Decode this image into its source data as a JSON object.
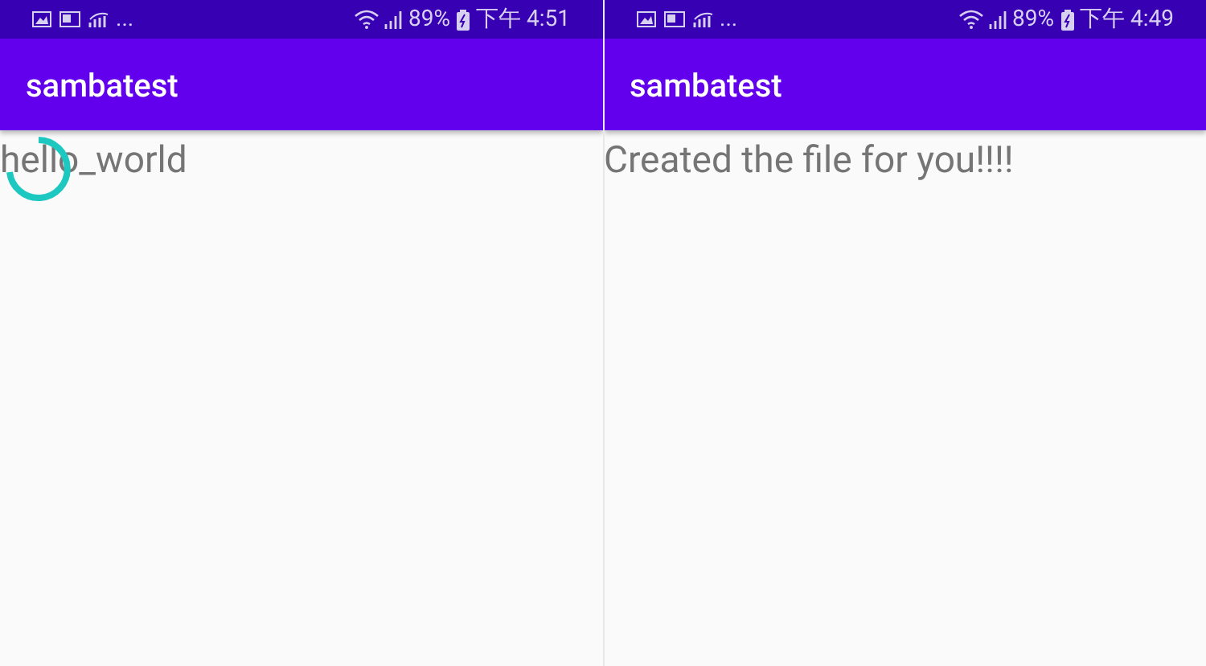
{
  "screens": [
    {
      "status_bar": {
        "more": "...",
        "battery": "89%",
        "time": "下午 4:51"
      },
      "title": "sambatest",
      "message": "hello_world",
      "loading": true
    },
    {
      "status_bar": {
        "more": "...",
        "battery": "89%",
        "time": "下午 4:49"
      },
      "title": "sambatest",
      "message": "Created the file for you!!!!",
      "loading": false
    }
  ]
}
